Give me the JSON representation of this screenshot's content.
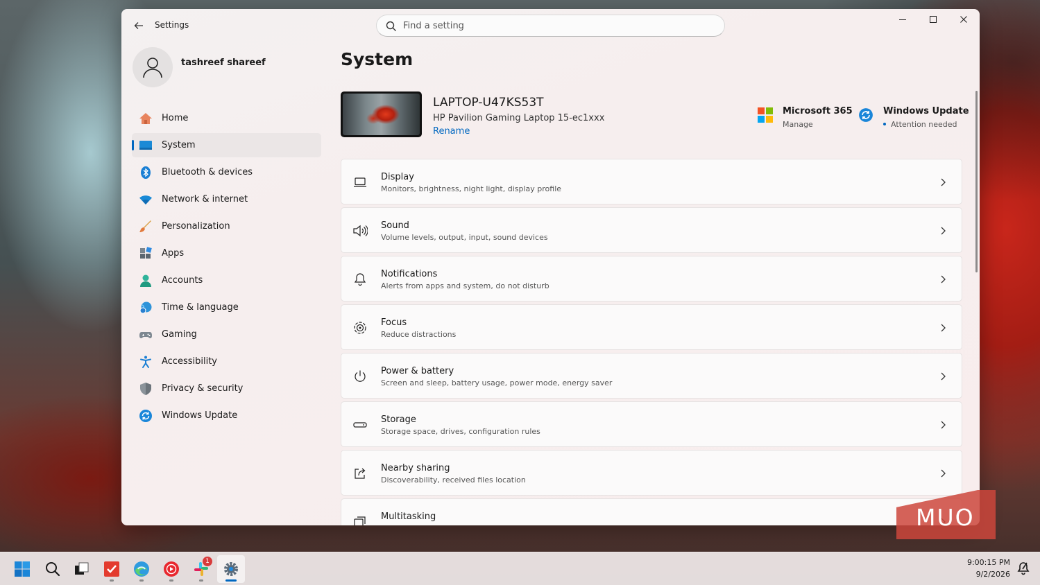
{
  "window": {
    "app_title": "Settings",
    "search_placeholder": "Find a setting"
  },
  "profile": {
    "name": "tashreef shareef"
  },
  "nav": {
    "items": [
      {
        "label": "Home",
        "icon": "home-icon"
      },
      {
        "label": "System",
        "icon": "system-icon",
        "active": true
      },
      {
        "label": "Bluetooth & devices",
        "icon": "bluetooth-icon"
      },
      {
        "label": "Network & internet",
        "icon": "wifi-icon"
      },
      {
        "label": "Personalization",
        "icon": "brush-icon"
      },
      {
        "label": "Apps",
        "icon": "apps-icon"
      },
      {
        "label": "Accounts",
        "icon": "person-icon"
      },
      {
        "label": "Time & language",
        "icon": "globe-clock-icon"
      },
      {
        "label": "Gaming",
        "icon": "gamepad-icon"
      },
      {
        "label": "Accessibility",
        "icon": "accessibility-icon"
      },
      {
        "label": "Privacy & security",
        "icon": "shield-icon"
      },
      {
        "label": "Windows Update",
        "icon": "update-icon"
      }
    ]
  },
  "main": {
    "title": "System",
    "device": {
      "name": "LAPTOP-U47KS53T",
      "model": "HP Pavilion Gaming Laptop 15-ec1xxx",
      "rename_label": "Rename"
    },
    "ms365": {
      "title": "Microsoft 365",
      "subtitle": "Manage"
    },
    "windows_update": {
      "title": "Windows Update",
      "subtitle": "Attention needed"
    },
    "cards": [
      {
        "title": "Display",
        "description": "Monitors, brightness, night light, display profile",
        "icon": "display-icon"
      },
      {
        "title": "Sound",
        "description": "Volume levels, output, input, sound devices",
        "icon": "speaker-icon"
      },
      {
        "title": "Notifications",
        "description": "Alerts from apps and system, do not disturb",
        "icon": "bell-icon"
      },
      {
        "title": "Focus",
        "description": "Reduce distractions",
        "icon": "focus-icon"
      },
      {
        "title": "Power & battery",
        "description": "Screen and sleep, battery usage, power mode, energy saver",
        "icon": "power-icon"
      },
      {
        "title": "Storage",
        "description": "Storage space, drives, configuration rules",
        "icon": "storage-icon"
      },
      {
        "title": "Nearby sharing",
        "description": "Discoverability, received files location",
        "icon": "share-icon"
      },
      {
        "title": "Multitasking",
        "description": "",
        "icon": "multitasking-icon"
      }
    ]
  },
  "watermark": {
    "text": "MUO"
  },
  "taskbar": {
    "apps": [
      "start-icon",
      "search-icon",
      "task-view-icon",
      "todo-app-icon",
      "edge-icon",
      "youtube-music-icon",
      "slack-icon",
      "settings-app-icon"
    ],
    "slack_badge": "1",
    "time": "9:00:15 PM",
    "date": "9/2/2026"
  },
  "colors": {
    "accent": "#0067c0",
    "window_bg": "#f6eeee"
  }
}
